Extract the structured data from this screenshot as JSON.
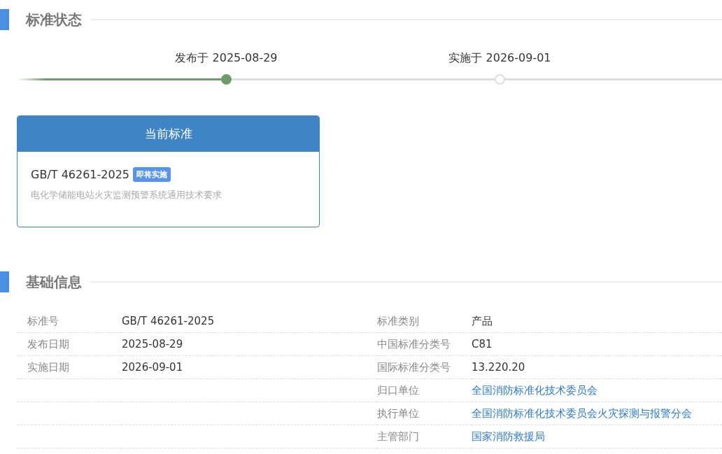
{
  "status_section": {
    "title": "标准状态",
    "milestones": [
      {
        "label": "发布于 2025-08-29",
        "reached": true
      },
      {
        "label": "实施于 2026-09-01",
        "reached": false
      }
    ],
    "current_card": {
      "header": "当前标准",
      "code": "GB/T 46261-2025",
      "badge": "即将实施",
      "name": "电化学储能电站火灾监测预警系统通用技术要求"
    }
  },
  "info_section": {
    "title": "基础信息",
    "rows": [
      {
        "left_label": "标准号",
        "left_value": "GB/T 46261-2025",
        "right_label": "标准类别",
        "right_value": "产品",
        "kind": "text"
      },
      {
        "left_label": "发布日期",
        "left_value": "2025-08-29",
        "right_label": "中国标准分类号",
        "right_value": "C81",
        "kind": "text"
      },
      {
        "left_label": "实施日期",
        "left_value": "2026-09-01",
        "right_label": "国际标准分类号",
        "right_value": "13.220.20",
        "kind": "text"
      },
      {
        "right_label": "归口单位",
        "right_value": "全国消防标准化技术委员会",
        "kind": "link"
      },
      {
        "right_label": "执行单位",
        "right_value": "全国消防标准化技术委员会火灾探测与报警分会",
        "kind": "link"
      },
      {
        "right_label": "主管部门",
        "right_value": "国家消防救援局",
        "kind": "link"
      }
    ]
  }
}
